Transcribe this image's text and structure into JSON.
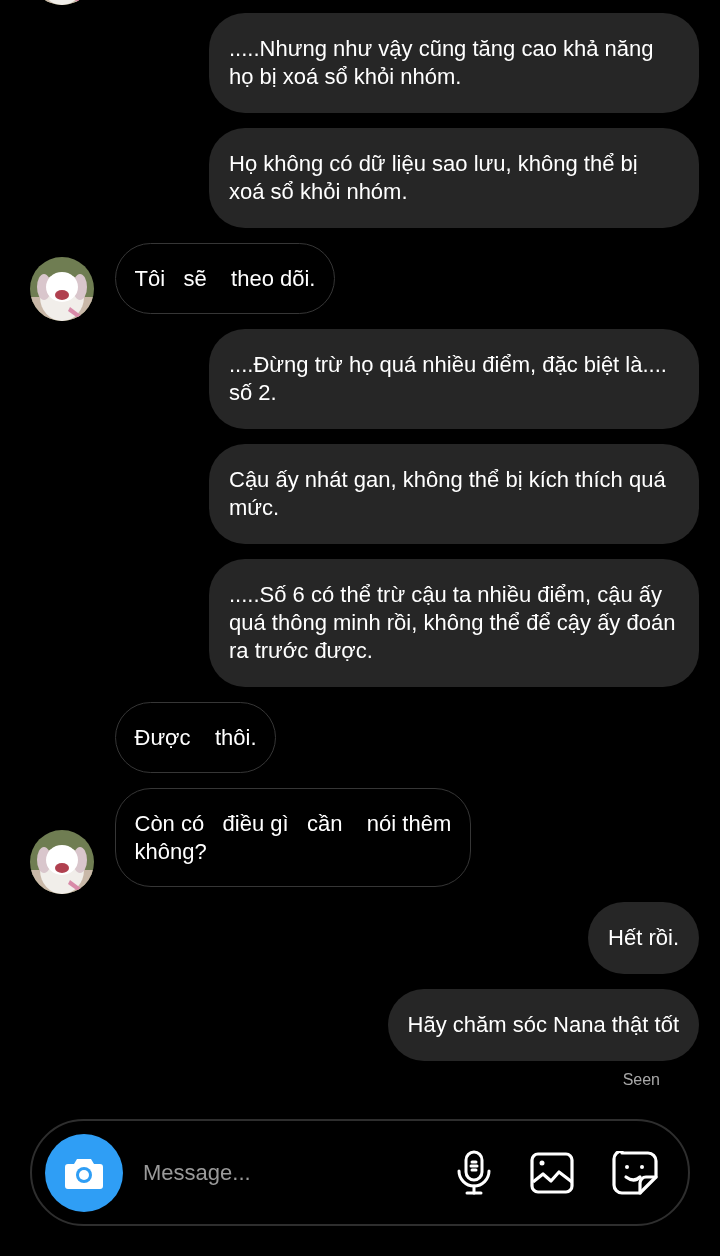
{
  "messages": [
    {
      "kind": "avatar"
    },
    {
      "kind": "sent",
      "text": ".....Nhưng như vậy cũng tăng cao khả năng họ bị xoá sổ khỏi nhóm."
    },
    {
      "kind": "sent",
      "text": "Họ không có dữ liệu sao lưu, không thể bị xoá sổ khỏi nhóm."
    },
    {
      "kind": "received",
      "avatar": true,
      "text": "Tôi   sẽ    theo dõi."
    },
    {
      "kind": "sent",
      "text": "....Đừng trừ họ quá nhiều điểm, đặc biệt là.... số 2."
    },
    {
      "kind": "sent",
      "text": "Cậu ấy nhát gan, không thể bị kích thích quá mức."
    },
    {
      "kind": "sent",
      "text": ".....Số 6 có thể trừ cậu ta nhiều điểm, cậu ấy quá thông minh rồi, không thể để cậy ấy đoán ra trước được."
    },
    {
      "kind": "received",
      "avatar": false,
      "text": "Được    thôi."
    },
    {
      "kind": "received",
      "avatar": true,
      "text": "Còn có   điều gì   cần    nói thêm\nkhông?"
    },
    {
      "kind": "sent",
      "text": "Hết rồi."
    },
    {
      "kind": "sent",
      "text": "Hãy chăm sóc Nana thật tốt"
    }
  ],
  "seen_label": "Seen",
  "composer": {
    "placeholder": "Message..."
  }
}
